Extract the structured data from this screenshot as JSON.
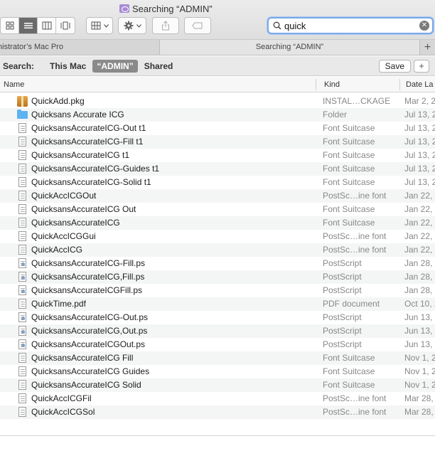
{
  "window": {
    "title": "Searching “ADMIN”"
  },
  "toolbar": {
    "view_icons": [
      "icon-view-icon",
      "list-view-icon",
      "column-view-icon",
      "cover-flow-icon"
    ],
    "active_view": 1,
    "search_value": "quick"
  },
  "tabs": [
    {
      "label": "Administrator’s Mac Pro"
    },
    {
      "label": "Searching “ADMIN”"
    }
  ],
  "scope": {
    "label": "Search:",
    "options": [
      "This Mac",
      "“ADMIN”",
      "Shared"
    ],
    "active": 1,
    "save_label": "Save",
    "add_label": "+"
  },
  "columns": {
    "name": "Name",
    "kind": "Kind",
    "date": "Date La"
  },
  "files": [
    {
      "name": "QuickAdd.pkg",
      "kind": "INSTAL…CKAGE",
      "date": "Mar 2, 2",
      "icon": "package-icon"
    },
    {
      "name": "Quicksans Accurate ICG",
      "kind": "Folder",
      "date": "Jul 13, 2",
      "icon": "folder-icon"
    },
    {
      "name": "QuicksansAccurateICG-Out t1",
      "kind": "Font Suitcase",
      "date": "Jul 13, 2",
      "icon": "document-icon"
    },
    {
      "name": "QuicksansAccurateICG-Fill t1",
      "kind": "Font Suitcase",
      "date": "Jul 13, 2",
      "icon": "document-icon"
    },
    {
      "name": "QuicksansAccurateICG t1",
      "kind": "Font Suitcase",
      "date": "Jul 13, 2",
      "icon": "document-icon"
    },
    {
      "name": "QuicksansAccurateICG-Guides t1",
      "kind": "Font Suitcase",
      "date": "Jul 13, 2",
      "icon": "document-icon"
    },
    {
      "name": "QuicksansAccurateICG-Solid t1",
      "kind": "Font Suitcase",
      "date": "Jul 13, 2",
      "icon": "document-icon"
    },
    {
      "name": "QuickAccICGOut",
      "kind": "PostSc…ine font",
      "date": "Jan 22, 2",
      "icon": "document-icon"
    },
    {
      "name": "QuicksansAccurateICG Out",
      "kind": "Font Suitcase",
      "date": "Jan 22, 2",
      "icon": "document-icon"
    },
    {
      "name": "QuicksansAccurateICG",
      "kind": "Font Suitcase",
      "date": "Jan 22, 2",
      "icon": "document-icon"
    },
    {
      "name": "QuickAccICGGui",
      "kind": "PostSc…ine font",
      "date": "Jan 22, 2",
      "icon": "document-icon"
    },
    {
      "name": "QuickAccICG",
      "kind": "PostSc…ine font",
      "date": "Jan 22, 2",
      "icon": "document-icon"
    },
    {
      "name": "QuicksansAccurateICG-Fill.ps",
      "kind": "PostScript",
      "date": "Jan 28, 2",
      "icon": "postscript-icon"
    },
    {
      "name": "QuicksansAccurateICG,Fill.ps",
      "kind": "PostScript",
      "date": "Jan 28, 2",
      "icon": "postscript-icon"
    },
    {
      "name": "QuicksansAccurateICGFill.ps",
      "kind": "PostScript",
      "date": "Jan 28, 2",
      "icon": "postscript-icon"
    },
    {
      "name": "QuickTime.pdf",
      "kind": "PDF document",
      "date": "Oct 10, 2",
      "icon": "document-icon"
    },
    {
      "name": "QuicksansAccurateICG-Out.ps",
      "kind": "PostScript",
      "date": "Jun 13, 2",
      "icon": "postscript-icon"
    },
    {
      "name": "QuicksansAccurateICG,Out.ps",
      "kind": "PostScript",
      "date": "Jun 13, 2",
      "icon": "postscript-icon"
    },
    {
      "name": "QuicksansAccurateICGOut.ps",
      "kind": "PostScript",
      "date": "Jun 13, 2",
      "icon": "postscript-icon"
    },
    {
      "name": "QuicksansAccurateICG Fill",
      "kind": "Font Suitcase",
      "date": "Nov 1, 2",
      "icon": "document-icon"
    },
    {
      "name": "QuicksansAccurateICG Guides",
      "kind": "Font Suitcase",
      "date": "Nov 1, 2",
      "icon": "document-icon"
    },
    {
      "name": "QuicksansAccurateICG Solid",
      "kind": "Font Suitcase",
      "date": "Nov 1, 2",
      "icon": "document-icon"
    },
    {
      "name": "QuickAccICGFil",
      "kind": "PostSc…ine font",
      "date": "Mar 28, 2",
      "icon": "document-icon"
    },
    {
      "name": "QuickAccICGSol",
      "kind": "PostSc…ine font",
      "date": "Mar 28, 2",
      "icon": "document-icon"
    }
  ]
}
